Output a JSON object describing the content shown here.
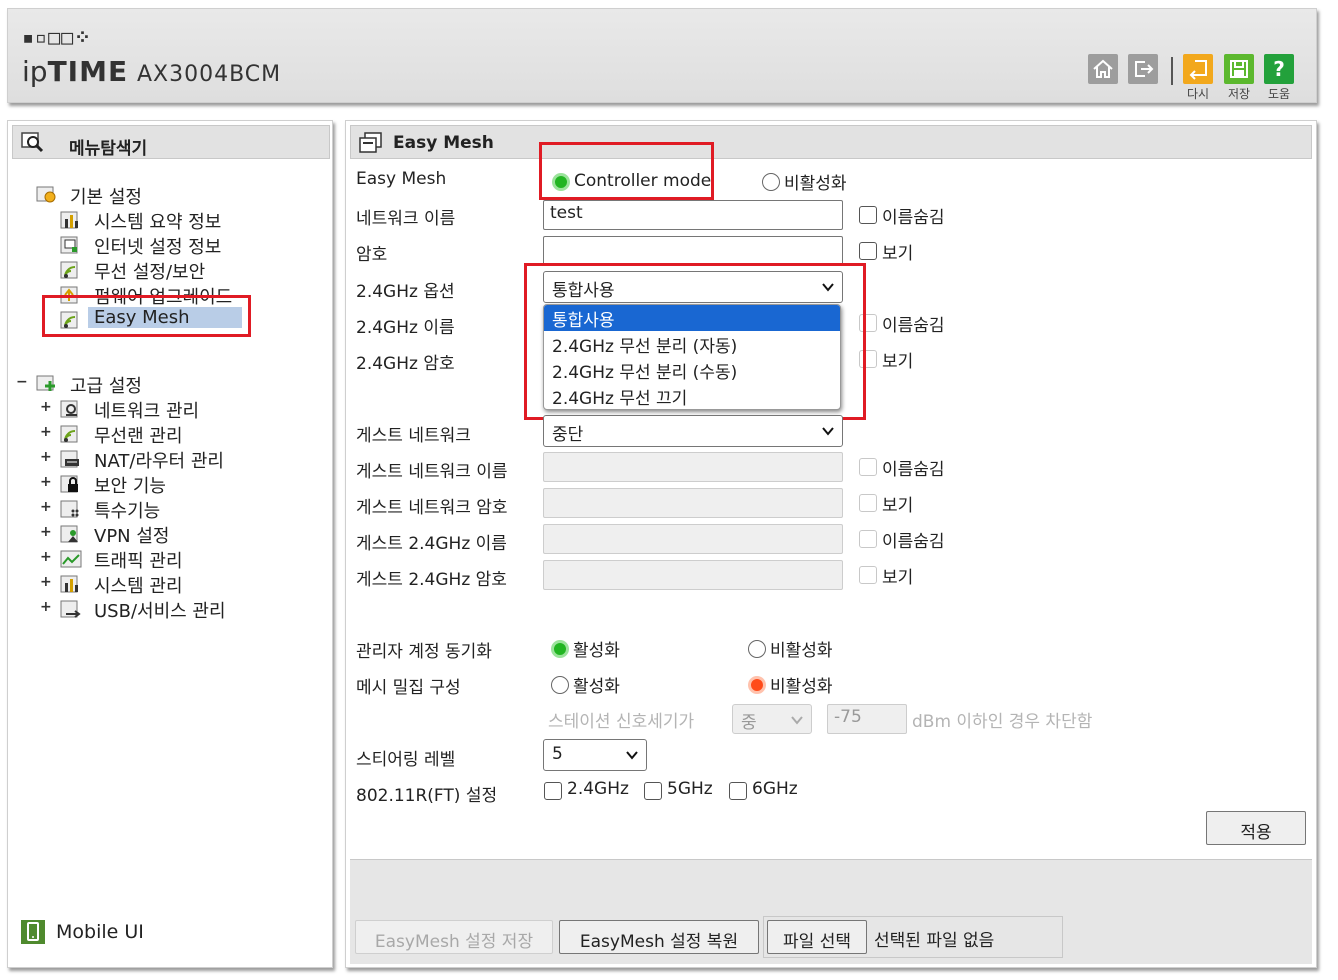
{
  "header": {
    "logo_dots": "▪▫□□⁘",
    "brand_bold": "TIME",
    "brand_prefix": "ip",
    "model": "AX3004BCM",
    "buttons": {
      "home": "",
      "logout": "",
      "restart_label": "다시",
      "save_label": "저장",
      "help_label": "도움"
    }
  },
  "sidebar": {
    "title": "메뉴탐색기",
    "basic_group": "기본 설정",
    "basic_items": [
      "시스템 요약 정보",
      "인터넷 설정 정보",
      "무선 설정/보안",
      "펌웨어 업그레이드",
      "Easy Mesh"
    ],
    "advanced_group": "고급 설정",
    "advanced_items": [
      "네트워크 관리",
      "무선랜 관리",
      "NAT/라우터 관리",
      "보안 기능",
      "특수기능",
      "VPN 설정",
      "트래픽 관리",
      "시스템 관리",
      "USB/서비스 관리"
    ],
    "mobile_ui": "Mobile UI",
    "expand_symbol": "+",
    "collapse_symbol": "−"
  },
  "main": {
    "title": "Easy Mesh",
    "easy_mesh_label": "Easy Mesh",
    "controller_mode": "Controller mode",
    "disabled": "비활성화",
    "enabled": "활성화",
    "network_name_label": "네트워크 이름",
    "network_name_value": "test",
    "hide_name": "이름숨김",
    "password_label": "암호",
    "show": "보기",
    "option_24_label": "2.4GHz 옵션",
    "option_24_value": "통합사용",
    "option_24_dropdown": [
      "통합사용",
      "2.4GHz 무선 분리 (자동)",
      "2.4GHz 무선 분리 (수동)",
      "2.4GHz 무선 끄기"
    ],
    "name_24_label": "2.4GHz 이름",
    "pw_24_label": "2.4GHz 암호",
    "guest_network_label": "게스트 네트워크",
    "guest_network_value": "중단",
    "guest_name_label": "게스트 네트워크 이름",
    "guest_pw_label": "게스트 네트워크 암호",
    "guest_24_name_label": "게스트 2.4GHz 이름",
    "guest_24_pw_label": "게스트 2.4GHz 암호",
    "admin_sync_label": "관리자 계정 동기화",
    "mesh_density_label": "메시 밀집 구성",
    "station_signal_label": "스테이션 신호세기가",
    "station_level": "중",
    "station_dbm": "-75",
    "station_suffix": "dBm 이하인 경우 차단함",
    "steering_label": "스티어링 레벨",
    "steering_value": "5",
    "ft_label": "802.11R(FT) 설정",
    "ft_24": "2.4GHz",
    "ft_5": "5GHz",
    "ft_6": "6GHz",
    "apply": "적용",
    "save_config": "EasyMesh 설정 저장",
    "restore_config": "EasyMesh 설정 복원",
    "file_select": "파일 선택",
    "no_file": "선택된 파일 없음"
  },
  "colors": {
    "highlight_red": "#e01b24",
    "radio_on": "#21b521",
    "radio_on_orange": "#ff4b1a",
    "dropdown_selected": "#1967d2"
  }
}
